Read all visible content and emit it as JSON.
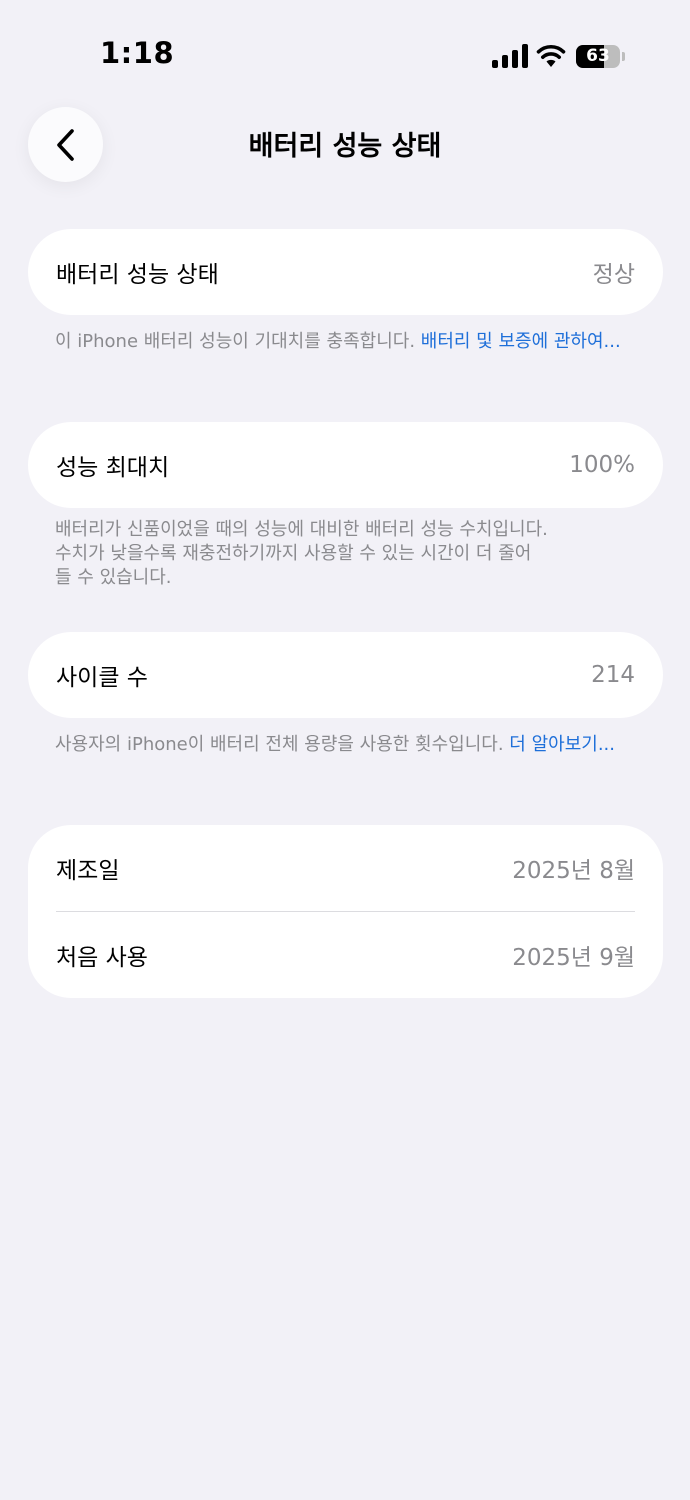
{
  "status_bar": {
    "time": "1:18",
    "battery_level": "63",
    "battery_fraction": 0.63
  },
  "header": {
    "title": "배터리 성능 상태",
    "back_icon": "chevron-left-icon"
  },
  "sections": {
    "health": {
      "label": "배터리 성능 상태",
      "value": "정상",
      "footnote": "이 iPhone 배터리 성능이 기대치를 충족합니다. ",
      "footnote_link": "배터리 및 보증에 관하여..."
    },
    "max_capacity": {
      "label": "성능 최대치",
      "value": "100%",
      "footnote_line1": "배터리가 신품이었을 때의 성능에 대비한 배터리 성능 수치입니다.",
      "footnote_line2": "수치가 낮을수록 재충전하기까지 사용할 수 있는 시간이 더 줄어",
      "footnote_line3": "들 수 있습니다."
    },
    "cycle_count": {
      "label": "사이클 수",
      "value": "214",
      "footnote": "사용자의 iPhone이 배터리 전체 용량을 사용한 횟수입니다. ",
      "footnote_link": "더 알아보기..."
    },
    "dates": {
      "manufacture_label": "제조일",
      "manufacture_value": "2025년 8월",
      "first_use_label": "처음 사용",
      "first_use_value": "2025년 9월"
    }
  },
  "colors": {
    "background": "#f2f1f7",
    "card": "#ffffff",
    "secondary_text": "#8a8a8e",
    "link": "#1e6fd9"
  }
}
